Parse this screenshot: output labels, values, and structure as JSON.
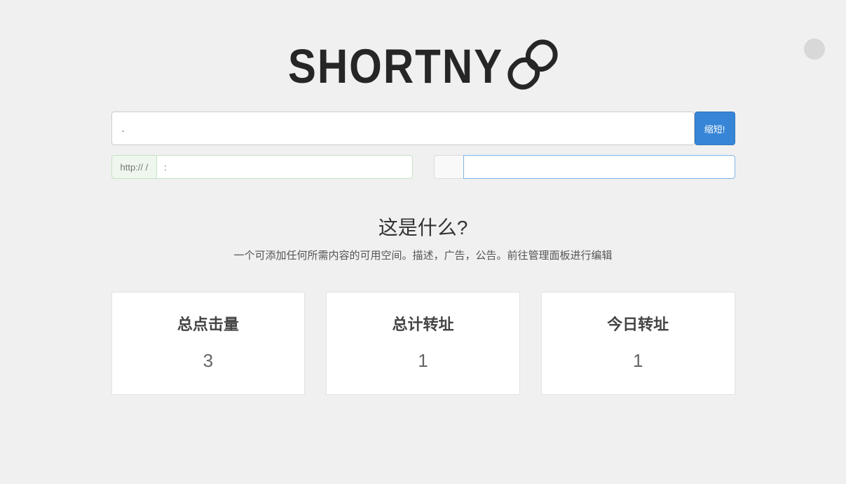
{
  "logo": {
    "text": "SHORTNY"
  },
  "form": {
    "url_value": ".",
    "shorten_label": "缩短!",
    "custom_prefix": "http://                  /",
    "custom_value": ":",
    "right_addon": " ",
    "right_value": " "
  },
  "what": {
    "title": "这是什么?",
    "desc": "一个可添加任何所需内容的可用空间。描述，广告，公告。前往管理面板进行编辑"
  },
  "stats": [
    {
      "label": "总点击量",
      "value": "3"
    },
    {
      "label": "总计转址",
      "value": "1"
    },
    {
      "label": "今日转址",
      "value": "1"
    }
  ]
}
